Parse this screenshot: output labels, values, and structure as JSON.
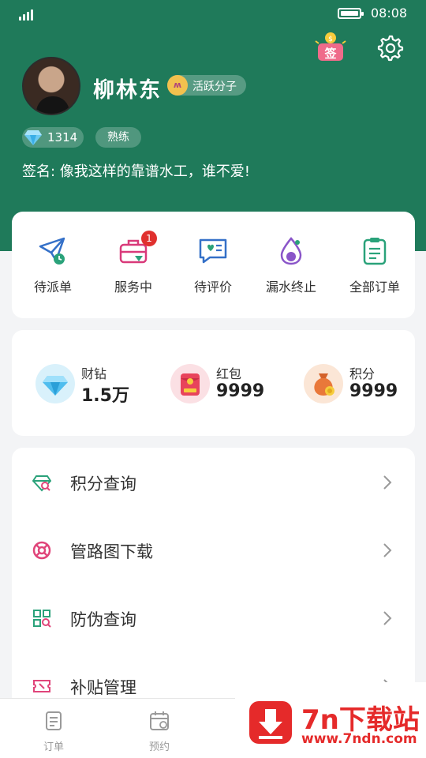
{
  "status_bar": {
    "time": "08:08"
  },
  "profile": {
    "name": "柳林东",
    "badge_logo": "ʍ",
    "badge": "活跃分子",
    "diamonds": "1314",
    "level": "熟练",
    "signature": "签名: 像我这样的靠谱水工，谁不爱!",
    "sign_in_label": "签"
  },
  "orders": [
    {
      "label": "待派单",
      "icon": "send-clock-icon"
    },
    {
      "label": "服务中",
      "icon": "toolbox-icon",
      "badge": "1"
    },
    {
      "label": "待评价",
      "icon": "chat-heart-icon"
    },
    {
      "label": "漏水终止",
      "icon": "water-drop-icon"
    },
    {
      "label": "全部订单",
      "icon": "clipboard-icon"
    }
  ],
  "wallet": [
    {
      "name": "财钻",
      "value": "1.5万",
      "icon": "diamond-icon"
    },
    {
      "name": "红包",
      "value": "9999",
      "icon": "red-packet-icon"
    },
    {
      "name": "积分",
      "value": "9999",
      "icon": "money-bag-icon"
    }
  ],
  "menu": [
    {
      "label": "积分查询",
      "icon": "gem-search-icon"
    },
    {
      "label": "管路图下载",
      "icon": "lifebuoy-icon"
    },
    {
      "label": "防伪查询",
      "icon": "qr-search-icon"
    },
    {
      "label": "补贴管理",
      "icon": "ticket-icon"
    }
  ],
  "tabbar": [
    {
      "label": "订单",
      "icon": "order-tab-icon"
    },
    {
      "label": "预约",
      "icon": "calendar-tab-icon"
    }
  ],
  "watermark": {
    "title": "7n下载站",
    "url": "www.7ndn.com"
  },
  "colors": {
    "brand_green": "#1f7a5a",
    "badge_red": "#e0302e",
    "watermark_red": "#e52a2a"
  }
}
